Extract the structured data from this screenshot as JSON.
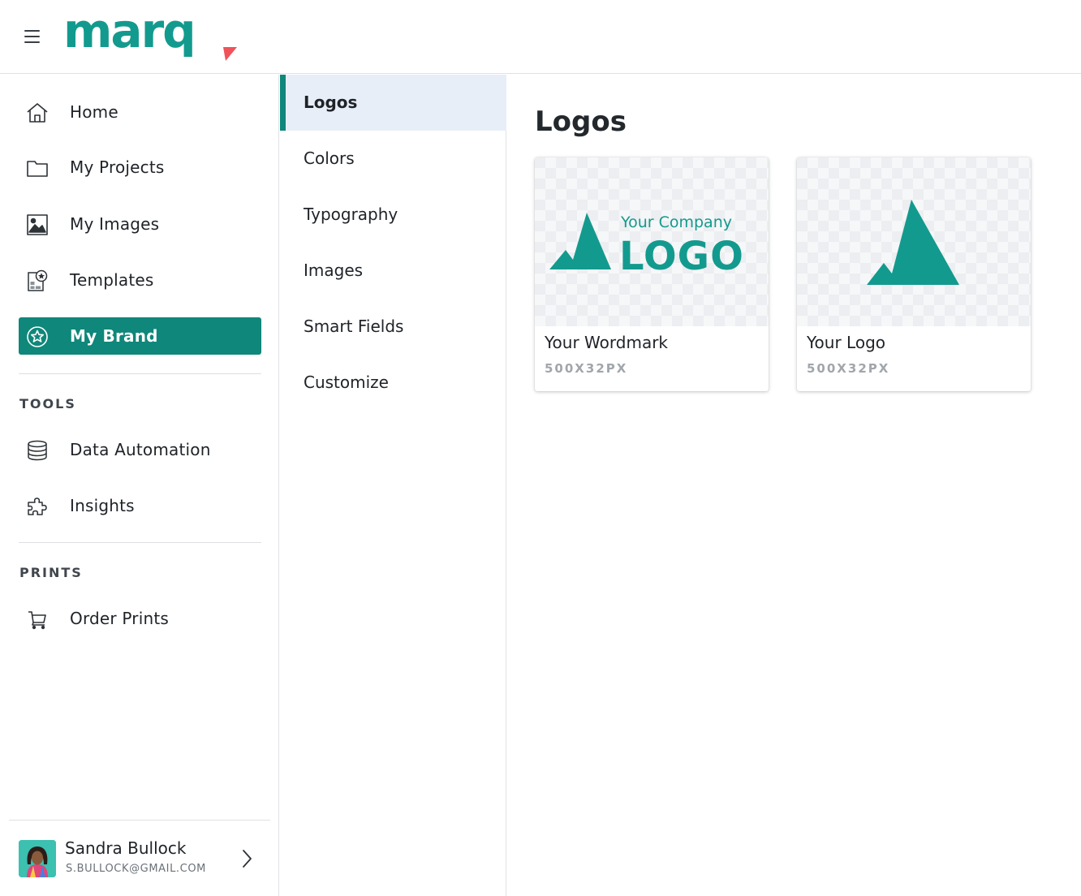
{
  "brand": {
    "name": "marq",
    "primary_color": "#0f877a",
    "teal_color": "#139a8e",
    "accent_color": "#f0525a"
  },
  "sidebar": {
    "items": [
      {
        "label": "Home",
        "icon": "home-icon"
      },
      {
        "label": "My Projects",
        "icon": "folder-icon"
      },
      {
        "label": "My Images",
        "icon": "image-icon"
      },
      {
        "label": "Templates",
        "icon": "templates-icon"
      },
      {
        "label": "My Brand",
        "icon": "brand-star-icon",
        "active": true
      }
    ],
    "tools_title": "TOOLS",
    "tools": [
      {
        "label": "Data Automation",
        "icon": "database-icon"
      },
      {
        "label": "Insights",
        "icon": "puzzle-icon"
      }
    ],
    "prints_title": "PRINTS",
    "prints": [
      {
        "label": "Order Prints",
        "icon": "cart-icon"
      }
    ]
  },
  "user": {
    "name": "Sandra Bullock",
    "email": "S.BULLOCK@GMAIL.COM"
  },
  "subnav": {
    "items": [
      {
        "label": "Logos",
        "active": true
      },
      {
        "label": "Colors"
      },
      {
        "label": "Typography"
      },
      {
        "label": "Images"
      },
      {
        "label": "Smart Fields"
      },
      {
        "label": "Customize"
      }
    ]
  },
  "main": {
    "title": "Logos",
    "cards": [
      {
        "title": "Your Wordmark",
        "size": "500X32PX",
        "preview_line1": "Your Company",
        "preview_line2": "LOGO"
      },
      {
        "title": "Your Logo",
        "size": "500X32PX"
      }
    ]
  }
}
